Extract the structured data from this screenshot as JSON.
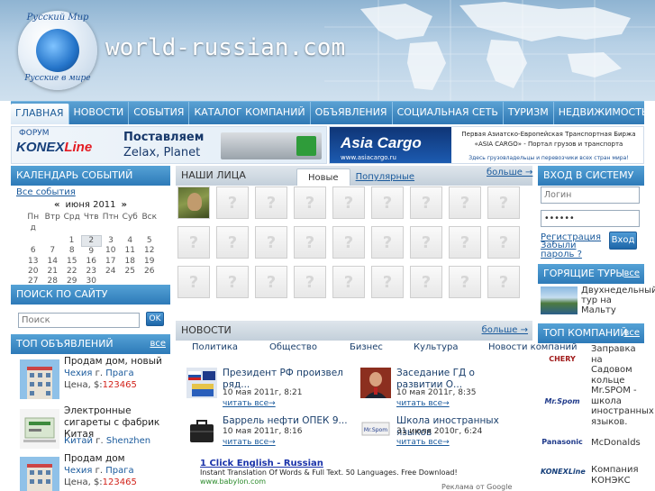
{
  "header": {
    "logo_top": "Русский Мир",
    "logo_bottom": "Русские в мире",
    "site_name": "world-russian.com"
  },
  "nav": [
    {
      "label": "ГЛАВНАЯ",
      "active": true
    },
    {
      "label": "НОВОСТИ"
    },
    {
      "label": "СОБЫТИЯ"
    },
    {
      "label": "КАТАЛОГ КОМПАНИЙ"
    },
    {
      "label": "ОБЪЯВЛЕНИЯ"
    },
    {
      "label": "СОЦИАЛЬНАЯ СЕТЬ"
    },
    {
      "label": "ТУРИЗМ"
    },
    {
      "label": "НЕДВИЖИМОСТЬ И БИЗНЕС"
    }
  ],
  "banner1": {
    "forum": "ФОРУМ",
    "brand_a": "KONEX",
    "brand_b": "Line",
    "line1": "Поставляем",
    "line2": "Zelax, Planet"
  },
  "banner2": {
    "brand": "Asia Cargo",
    "line1": "Первая Азиатско-Европейская Транспортная Биржа",
    "line2": "«ASIA CARGO» - Портал грузов и транспорта",
    "url": "www.asiacargo.ru",
    "line3": "Здесь грузовладельцы и перевозчики всех стран мира!"
  },
  "calendar": {
    "title": "КАЛЕНДАРЬ СОБЫТИЙ",
    "all_events": "Все события",
    "prev": "«",
    "next": "»",
    "month": "июня 2011",
    "weekdays": [
      "Пн\nд",
      "Втр",
      "Срд",
      "Чтв",
      "Птн",
      "Суб",
      "Вск"
    ],
    "weeks": [
      [
        "",
        "",
        "1",
        "2",
        "3",
        "4",
        "5"
      ],
      [
        "6",
        "7",
        "8",
        "9",
        "10",
        "11",
        "12"
      ],
      [
        "13",
        "14",
        "15",
        "16",
        "17",
        "18",
        "19"
      ],
      [
        "20",
        "21",
        "22",
        "23",
        "24",
        "25",
        "26"
      ],
      [
        "27",
        "28",
        "29",
        "30",
        "",
        "",
        ""
      ]
    ],
    "today": "2"
  },
  "search": {
    "title": "ПОИСК ПО САЙТУ",
    "placeholder": "Поиск",
    "button": "OK"
  },
  "ads": {
    "title": "ТОП ОБЪЯВЛЕНИЙ",
    "more": "все",
    "items": [
      {
        "title": "Продам дом, новый",
        "country": "Чехия",
        "city_prefix": "г.",
        "city": "Прага",
        "price_label": "Цена, $:",
        "price": "123465"
      },
      {
        "title": "Электронные сигареты с фабрик Китая",
        "country": "Китай",
        "city_prefix": "г.",
        "city": "Shenzhen",
        "price_label": "",
        "price": ""
      },
      {
        "title": "Продам дом",
        "country": "Чехия",
        "city_prefix": "г.",
        "city": "Прага",
        "price_label": "Цена, $:",
        "price": "123465"
      }
    ]
  },
  "faces": {
    "title": "НАШИ ЛИЦА",
    "tab_new": "Новые",
    "tab_popular": "Популярные",
    "more": "больше →",
    "placeholder_glyph": "?",
    "count": 27
  },
  "news": {
    "title": "НОВОСТИ",
    "more": "больше →",
    "categories": [
      "Политика",
      "Общество",
      "Бизнес",
      "Культура",
      "Новости компаний"
    ],
    "items": [
      {
        "headline": "Президент РФ произвел ряд...",
        "date": "10 мая 2011г, 8:21",
        "read": "читать все→"
      },
      {
        "headline": "Заседание ГД о развитии О...",
        "date": "10 мая 2011г, 8:35",
        "read": "читать все→"
      },
      {
        "headline": "Баррель нефти ОПЕК 9...",
        "date": "10 мая 2011г, 8:16",
        "read": "читать все→"
      },
      {
        "headline": "Школа иностранных языков",
        "date": "31 июля 2010г, 6:24",
        "read": "читать все→"
      }
    ]
  },
  "text_ad": {
    "link": "1 Click English - Russian",
    "text": "Instant Translation Of Words & Full Text. 50 Languages. Free Download!",
    "url": "www.babylon.com",
    "by": "Реклама от Google"
  },
  "login": {
    "title": "ВХОД В СИСТЕМУ",
    "login_placeholder": "Логин",
    "password_value": "••••••",
    "register": "Регистрация",
    "forgot": "Забыли пароль ?",
    "button": "Вход"
  },
  "tours": {
    "title": "ГОРЯЩИЕ ТУРЫ",
    "more": "все",
    "item": "Двухнедельный тур на Мальту"
  },
  "companies": {
    "title": "ТОП КОМПАНИЙ",
    "more": "все",
    "items": [
      {
        "logo": "CHERY",
        "name": "Заправка на Садовом кольце"
      },
      {
        "logo": "Mr.Spom",
        "name": "Mr.SPOM - школа иностранных языков."
      },
      {
        "logo": "Panasonic",
        "name": "McDonalds"
      },
      {
        "logo": "KONEXLine",
        "name": "Компания КОНЭКС"
      }
    ]
  },
  "colors": {
    "nav_blue": "#2f78b4",
    "accent_red": "#d2231b",
    "link_blue": "#1a5a9c"
  }
}
